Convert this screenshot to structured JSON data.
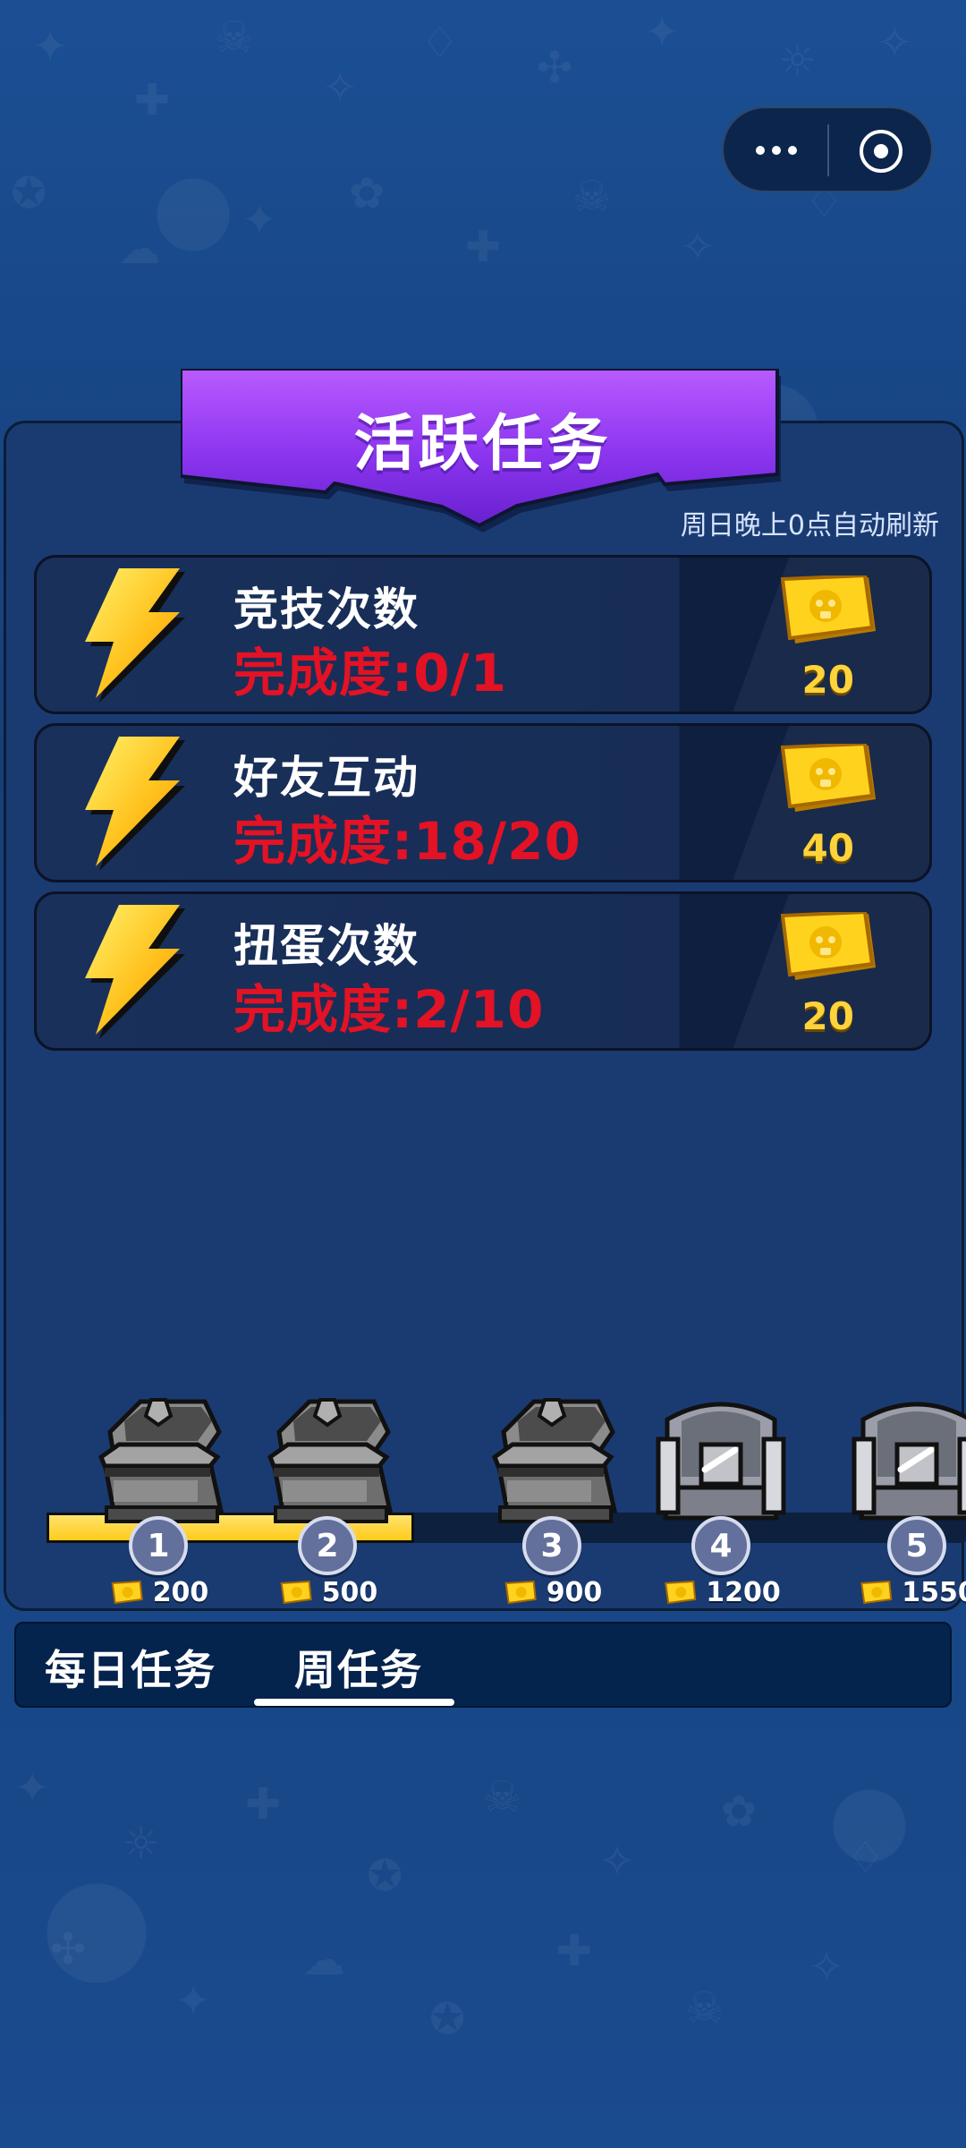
{
  "window_controls": {
    "more_icon": "more-icon",
    "record_icon": "record-icon"
  },
  "header": {
    "title": "活跃任务",
    "refresh_note": "周日晚上0点自动刷新"
  },
  "tasks": [
    {
      "name": "竞技次数",
      "progress": "完成度:0/1",
      "reward": "20"
    },
    {
      "name": "好友互动",
      "progress": "完成度:18/20",
      "reward": "40"
    },
    {
      "name": "扭蛋次数",
      "progress": "完成度:2/10",
      "reward": "20"
    }
  ],
  "milestones": [
    {
      "index": "1",
      "reward": "200",
      "state": "opened"
    },
    {
      "index": "2",
      "reward": "500",
      "state": "opened"
    },
    {
      "index": "3",
      "reward": "900",
      "state": "opened"
    },
    {
      "index": "4",
      "reward": "1200",
      "state": "locked"
    },
    {
      "index": "5",
      "reward": "1550",
      "state": "locked"
    }
  ],
  "progress": {
    "completed_fraction": 0.4
  },
  "tabs": [
    {
      "label": "每日任务",
      "active": false
    },
    {
      "label": "周任务",
      "active": true
    }
  ],
  "colors": {
    "background": "#12417d",
    "panel": "#1a3b72",
    "banner_top": "#a14cff",
    "banner_bottom": "#6a20d4",
    "progress_red": "#e31225",
    "reward_gold": "#ffd33a",
    "tab_bar": "#04234d"
  }
}
